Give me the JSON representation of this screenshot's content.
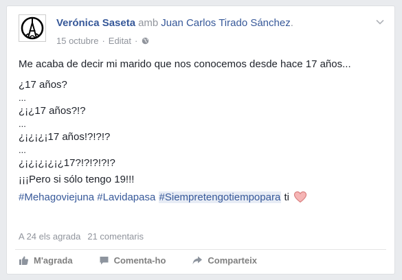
{
  "post": {
    "author": "Verónica Saseta",
    "with_word": "amb",
    "tagged": "Juan Carlos Tirado Sánchez",
    "tagged_suffix": ".",
    "date": "15 octubre",
    "separator": "·",
    "edited": "Editat",
    "text_lines": [
      "Me acaba de decir mi marido que nos conocemos desde hace 17 años...",
      "¿17 años?",
      "...",
      "¿¡¿17 años?!?",
      "...",
      "¿¡¿¡¿¡17 años!?!?!?",
      "...",
      "¿¡¿¡¿¡¿¡¿17?!?!?!?!?",
      "¡¡¡Pero si sólo tengo 19!!!"
    ],
    "hashtags": [
      "#Mehagoviejuna",
      "#Lavidapasa",
      "#Siempretengotiempopara"
    ],
    "hashtag_suffix": "ti"
  },
  "stats": {
    "likes": "A 24 els agrada",
    "comments": "21 comentaris"
  },
  "actions": {
    "like": "M'agrada",
    "comment": "Comenta-ho",
    "share": "Comparteix"
  },
  "icons": {
    "avatar": "peace-eiffel-icon",
    "privacy": "globe-icon",
    "menu": "chevron-down-icon",
    "emoji": "heart-icon",
    "like": "thumbs-up-icon",
    "comment": "comment-icon",
    "share": "share-arrow-icon"
  },
  "colors": {
    "link": "#365899",
    "muted": "#90949c",
    "text": "#1d2129",
    "highlight": "#e7ecf5",
    "heart": "#f5a3a3"
  }
}
